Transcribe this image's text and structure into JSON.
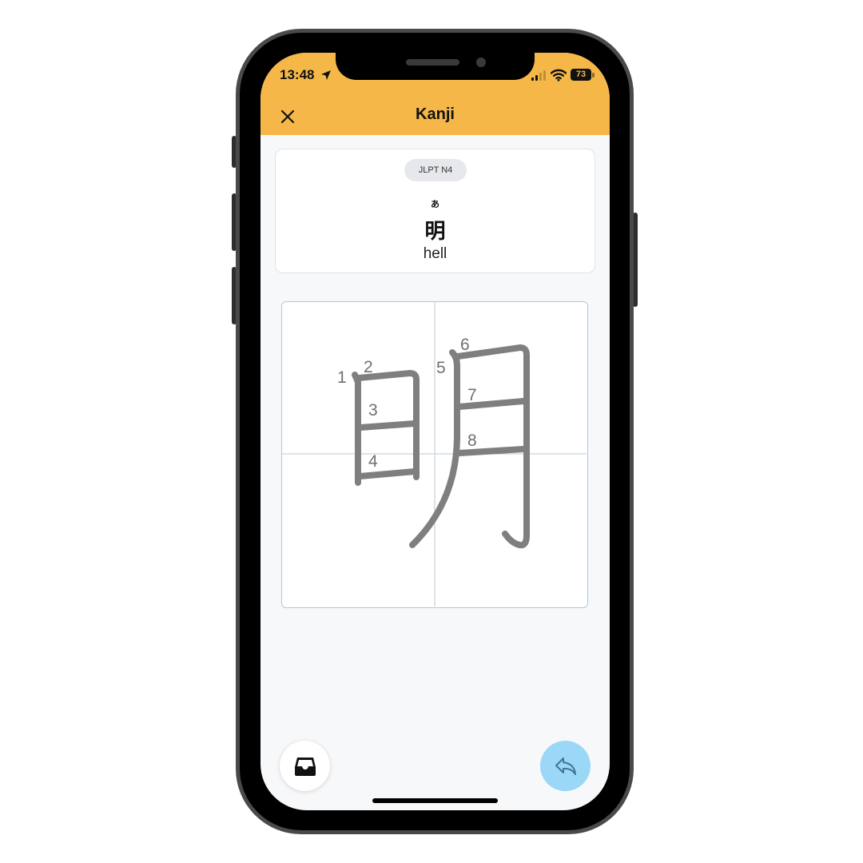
{
  "status_bar": {
    "time": "13:48",
    "battery": "73"
  },
  "header": {
    "title": "Kanji",
    "close_icon": "close-icon",
    "background": "#f6b749"
  },
  "kanji_card": {
    "jlpt_level": "JLPT N4",
    "furigana": "あ",
    "kanji": "明",
    "meaning": "hell"
  },
  "stroke_diagram": {
    "stroke_color": "#7f7f7f",
    "guide_color": "#c9d3dd",
    "stroke_numbers": [
      "1",
      "2",
      "3",
      "4",
      "5",
      "6",
      "7",
      "8"
    ]
  },
  "actions": {
    "left_icon": "inbox-tray-icon",
    "right_icon": "reply-arrow-icon",
    "right_color": "#9bd7f7"
  }
}
